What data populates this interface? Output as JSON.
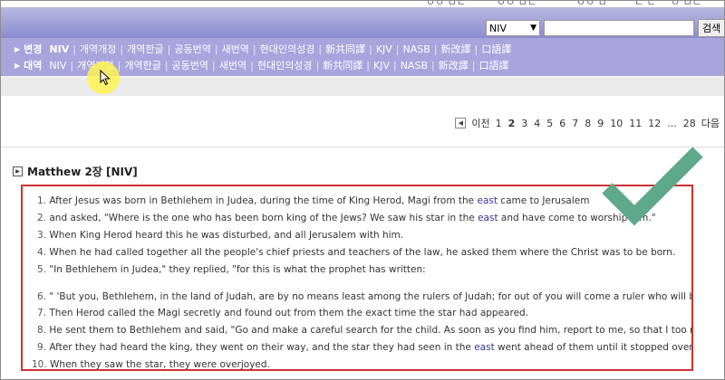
{
  "top_cut_text": [
    "ㅇㅇ ㅁㄴ",
    "ㅇㅇ ㅁㄴ",
    "ㅇㅇ ㅁ",
    "ㄷ ㄴ",
    "ㅇ ㅁㄴ"
  ],
  "search": {
    "version_selected": "NIV",
    "input_value": "",
    "button_label": "검색"
  },
  "menu": {
    "row1_label": "변경",
    "row2_label": "대역",
    "items": [
      "NIV",
      "개역개정",
      "개역한글",
      "공동번역",
      "새번역",
      "현대인의성경",
      "新共同譯",
      "KJV",
      "NASB",
      "新改譯",
      "口語譯"
    ]
  },
  "pager": {
    "prev_label": "이전",
    "pages": [
      "1",
      "2",
      "3",
      "4",
      "5",
      "6",
      "7",
      "8",
      "9",
      "10",
      "11",
      "12",
      "...",
      "28"
    ],
    "next_label": "다음"
  },
  "chapter": {
    "title": "Matthew 2장 [NIV]",
    "verses": [
      {
        "num": "1.",
        "pre": "After Jesus was born in Bethlehem in Judea, during the time of King Herod, Magi from the ",
        "east": "east",
        "post": " came to Jerusalem"
      },
      {
        "num": "2.",
        "pre": "and asked, \"Where is the one who has been born king of the Jews? We saw his star in the ",
        "east": "east",
        "post": " and have come to worship him.\""
      },
      {
        "num": "3.",
        "pre": "When King Herod heard this he was disturbed, and all Jerusalem with him.",
        "east": "",
        "post": ""
      },
      {
        "num": "4.",
        "pre": "When he had called together all the people's chief priests and teachers of the law, he asked them where the Christ was to be born.",
        "east": "",
        "post": ""
      },
      {
        "num": "5.",
        "pre": "\"In Bethlehem in Judea,\" they replied, \"for this is what the prophet has written:",
        "east": "",
        "post": ""
      },
      {
        "num": "6.",
        "pre": "\" 'But you, Bethlehem, in the land of Judah, are by no means least among the rulers of Judah; for out of you will come a ruler who will be the shepherd of my people Israel.' \"",
        "east": "",
        "post": ""
      },
      {
        "num": "7.",
        "pre": "Then Herod called the Magi secretly and found out from them the exact time the star had appeared.",
        "east": "",
        "post": ""
      },
      {
        "num": "8.",
        "pre": "He sent them to Bethlehem and said, \"Go and make a careful search for the child. As soon as you find him, report to me, so that I too may go and worship him.\"",
        "east": "",
        "post": ""
      },
      {
        "num": "9.",
        "pre": "After they had heard the king, they went on their way, and the star they had seen in the ",
        "east": "east",
        "post": " went ahead of them until it stopped over the place where the child was."
      },
      {
        "num": "10.",
        "pre": "When they saw the star, they were overjoyed.",
        "east": "",
        "post": ""
      }
    ]
  },
  "colors": {
    "menu_bg": "#a8a4dc",
    "highlight_box": "#cc3333",
    "checkmark": "#5fa88a",
    "cursor_halo": "#fff550"
  }
}
